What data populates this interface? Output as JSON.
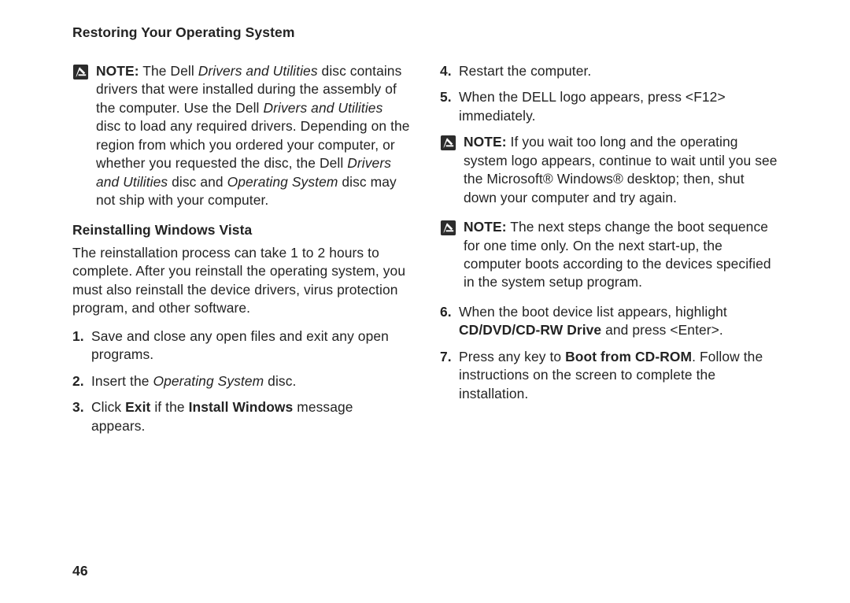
{
  "header": {
    "title": "Restoring Your Operating System"
  },
  "left": {
    "note1": {
      "label": "NOTE:",
      "t1": " The Dell ",
      "it1": "Drivers and Utilities",
      "t2": " disc contains drivers that were installed during the assembly of the computer. Use the Dell ",
      "it2": "Drivers and Utilities",
      "t3": " disc to load any required drivers. Depending on the region from which you ordered your computer, or whether you requested the disc, the Dell ",
      "it3": "Drivers and Utilities",
      "t4": " disc and ",
      "it4": "Operating System",
      "t5": " disc may not ship with your computer."
    },
    "subheading": "Reinstalling Windows Vista",
    "para": "The reinstallation process can take 1 to 2 hours to complete. After you reinstall the operating system, you must also reinstall the device drivers, virus protection program, and other software.",
    "steps": {
      "s1": {
        "num": "1.",
        "txt": "Save and close any open files and exit any open programs."
      },
      "s2": {
        "num": "2.",
        "t1": "Insert the ",
        "it": "Operating System",
        "t2": " disc."
      },
      "s3": {
        "num": "3.",
        "t1": "Click ",
        "b1": "Exit",
        "t2": " if the ",
        "b2": "Install Windows",
        "t3": " message appears."
      }
    }
  },
  "right": {
    "steps_top": {
      "s4": {
        "num": "4.",
        "txt": "Restart the computer."
      },
      "s5": {
        "num": "5.",
        "txt": "When the DELL logo appears, press <F12> immediately."
      }
    },
    "note2": {
      "label": "NOTE:",
      "txt": " If you wait too long and the operating system logo appears, continue to wait until you see the Microsoft® Windows® desktop; then, shut down your computer and try again."
    },
    "note3": {
      "label": "NOTE:",
      "txt": " The next steps change the boot sequence for one time only. On the next start-up, the computer boots according to the devices specified in the system setup program."
    },
    "steps_bottom": {
      "s6": {
        "num": "6.",
        "t1": "When the boot device list appears, highlight ",
        "b": "CD/DVD/CD-RW Drive",
        "t2": " and press <Enter>."
      },
      "s7": {
        "num": "7.",
        "t1": "Press any key to ",
        "b": "Boot from CD-ROM",
        "t2": ". Follow the instructions on the screen to complete the installation."
      }
    }
  },
  "page_number": "46"
}
